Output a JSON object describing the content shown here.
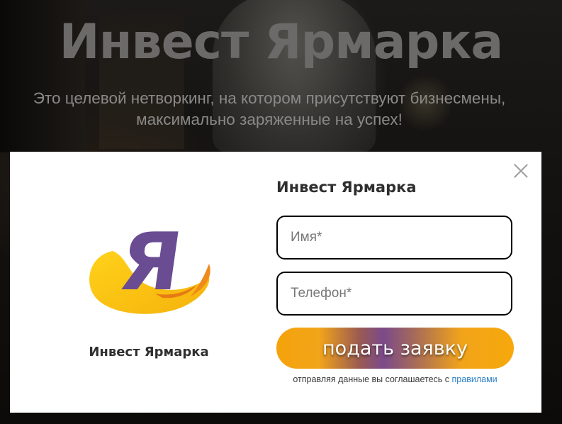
{
  "hero": {
    "title": "Инвест Ярмарка",
    "subtitle_line1": "Это целевой нетворкинг, на котором присутствуют бизнесмены,",
    "subtitle_line2": "максимально заряженные на успех!"
  },
  "modal": {
    "logo_letter": "Я",
    "logo_caption": "Инвест Ярмарка",
    "form_title": "Инвест Ярмарка",
    "fields": {
      "name_placeholder": "Имя*",
      "phone_placeholder": "Телефон*"
    },
    "submit_label": "подать заявку",
    "consent_text": "отправляя данные вы соглашаетесь с",
    "consent_link": "правилами"
  },
  "icons": {
    "close": "close-icon",
    "logo": "logo-icon"
  },
  "colors": {
    "brand_purple": "#6a4c93",
    "brand_yellow": "#f9c21a",
    "brand_orange": "#f08a1c",
    "link": "#2c7fc6"
  }
}
